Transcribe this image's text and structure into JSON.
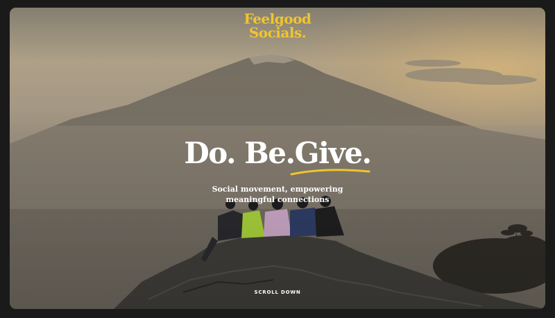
{
  "brand": {
    "line1": "Feelgood",
    "line2": "Socials.",
    "color": "#f0c52d"
  },
  "hero": {
    "headline": "Do. Be.Give.",
    "subtitle_line1": "Social movement, empowering",
    "subtitle_line2": "meaningful connections",
    "underline_color": "#f0c52d"
  },
  "scroll": {
    "label": "SCROLL DOWN"
  },
  "background": {
    "icon": "mountain-photo"
  }
}
